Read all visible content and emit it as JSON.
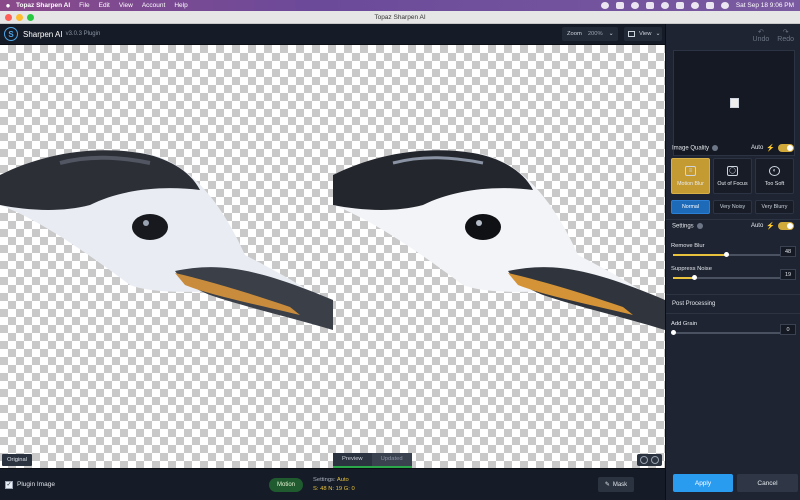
{
  "menubar": {
    "app_name": "Topaz Sharpen AI",
    "items": [
      "File",
      "Edit",
      "View",
      "Account",
      "Help"
    ],
    "clock": "Sat Sep 18  9:06 PM"
  },
  "window": {
    "title": "Topaz Sharpen AI"
  },
  "header": {
    "app_name": "Sharpen AI",
    "version": "v3.0.3 Plugin",
    "zoom_label": "Zoom",
    "zoom_value": "200%",
    "view_label": "View"
  },
  "canvas": {
    "original_label": "Original",
    "preview_tab": "Preview",
    "updated_tab": "Updated"
  },
  "bottom_bar": {
    "plugin_image_label": "Plugin Image",
    "model_pill": "Motion",
    "settings_label": "Settings:",
    "settings_value": "Auto",
    "s_label": "S:",
    "s_value": "48",
    "n_label": "N:",
    "n_value": "19",
    "g_label": "G:",
    "g_value": "0",
    "mask_label": "Mask"
  },
  "right_panel": {
    "undo_label": "Undo",
    "redo_label": "Redo",
    "image_quality_title": "Image Quality",
    "auto_label": "Auto",
    "modes": [
      {
        "label": "Motion Blur",
        "active": true
      },
      {
        "label": "Out of Focus",
        "active": false
      },
      {
        "label": "Too Soft",
        "active": false
      }
    ],
    "noise_levels": [
      {
        "label": "Normal",
        "active": true
      },
      {
        "label": "Very Noisy",
        "active": false
      },
      {
        "label": "Very Blurry",
        "active": false
      }
    ],
    "settings_title": "Settings",
    "remove_blur": {
      "label": "Remove Blur",
      "value": "48",
      "fraction": 0.48
    },
    "suppress_noise": {
      "label": "Suppress Noise",
      "value": "19",
      "fraction": 0.19
    },
    "post_processing_title": "Post Processing",
    "add_grain": {
      "label": "Add Grain",
      "value": "0",
      "fraction": 0
    },
    "apply_label": "Apply",
    "cancel_label": "Cancel"
  },
  "colors": {
    "accent_gold": "#c49a32",
    "accent_blue": "#2a9cf0",
    "panel_bg": "#1e2431"
  }
}
